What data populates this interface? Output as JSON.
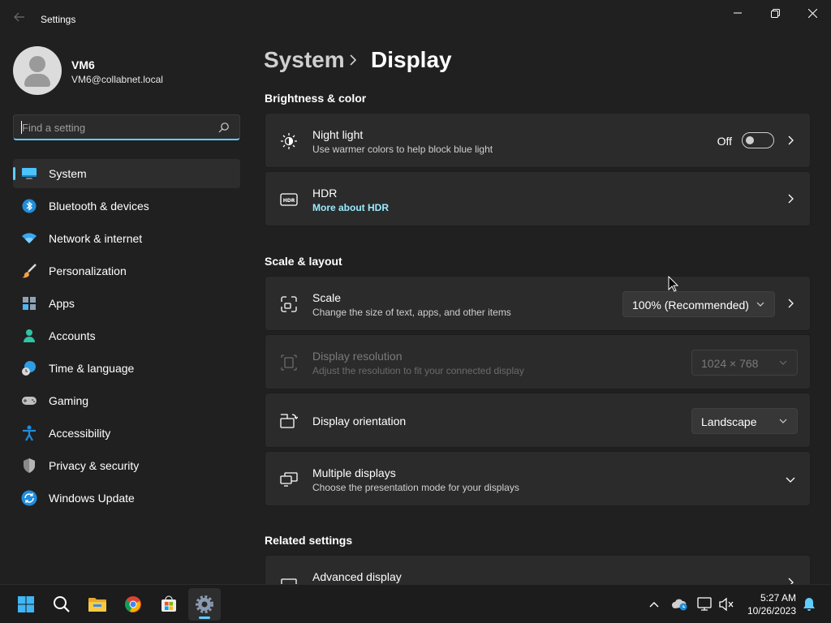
{
  "window": {
    "title": "Settings"
  },
  "user": {
    "name": "VM6",
    "email": "VM6@collabnet.local"
  },
  "search": {
    "placeholder": "Find a setting"
  },
  "sidebar": {
    "items": [
      {
        "label": "System",
        "icon": "monitor-icon",
        "active": true
      },
      {
        "label": "Bluetooth & devices",
        "icon": "bluetooth-icon"
      },
      {
        "label": "Network & internet",
        "icon": "wifi-icon"
      },
      {
        "label": "Personalization",
        "icon": "paintbrush-icon"
      },
      {
        "label": "Apps",
        "icon": "apps-icon"
      },
      {
        "label": "Accounts",
        "icon": "person-icon"
      },
      {
        "label": "Time & language",
        "icon": "globe-clock-icon"
      },
      {
        "label": "Gaming",
        "icon": "gamepad-icon"
      },
      {
        "label": "Accessibility",
        "icon": "accessibility-icon"
      },
      {
        "label": "Privacy & security",
        "icon": "shield-icon"
      },
      {
        "label": "Windows Update",
        "icon": "update-icon"
      }
    ]
  },
  "breadcrumb": {
    "parent": "System",
    "current": "Display"
  },
  "sections": {
    "brightness": "Brightness & color",
    "scale_layout": "Scale & layout",
    "related": "Related settings"
  },
  "cards": {
    "night_light": {
      "title": "Night light",
      "subtitle": "Use warmer colors to help block blue light",
      "toggle_label": "Off",
      "toggle_on": false
    },
    "hdr": {
      "title": "HDR",
      "link": "More about HDR"
    },
    "scale": {
      "title": "Scale",
      "subtitle": "Change the size of text, apps, and other items",
      "value": "100% (Recommended)"
    },
    "resolution": {
      "title": "Display resolution",
      "subtitle": "Adjust the resolution to fit your connected display",
      "value": "1024 × 768",
      "enabled": false
    },
    "orientation": {
      "title": "Display orientation",
      "value": "Landscape"
    },
    "multiple": {
      "title": "Multiple displays",
      "subtitle": "Choose the presentation mode for your displays"
    },
    "advanced": {
      "title": "Advanced display"
    }
  },
  "taskbar": {
    "apps": [
      "start-icon",
      "search-icon",
      "file-explorer-icon",
      "chrome-icon",
      "store-icon",
      "settings-icon"
    ],
    "time": "5:27 AM",
    "date": "10/26/2023"
  },
  "colors": {
    "accent": "#60cdff",
    "background": "#202020",
    "card": "#2b2b2b"
  }
}
